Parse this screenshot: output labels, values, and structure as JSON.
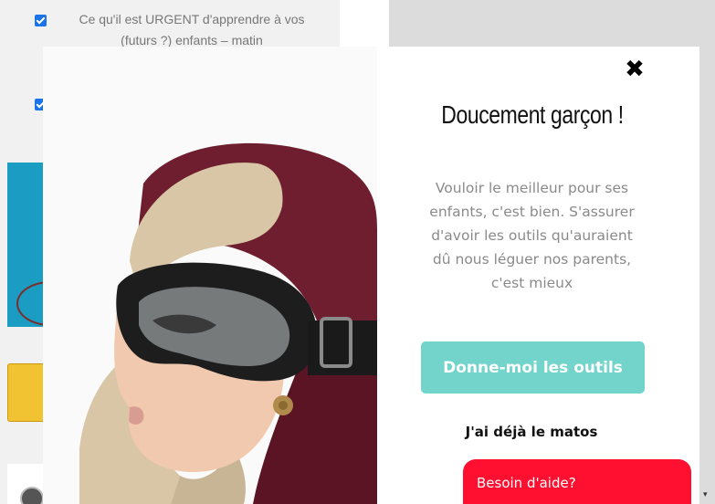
{
  "background": {
    "list_item_1": "Ce qu'il est URGENT d'apprendre à vos (futurs ?) enfants – matin"
  },
  "popup": {
    "close_icon": "close-icon",
    "close_symbol": "✖",
    "title": "Doucement garçon !",
    "description": "Vouloir le meilleur pour ses enfants, c'est bien. S'assurer d'avoir les outils qu'auraient dû nous léguer nos parents, c'est mieux",
    "cta_label": "Donne-moi les outils",
    "secondary_label": "J'ai déjà le matos",
    "cta_color": "#72d4cb"
  },
  "help_widget": {
    "label": "Besoin d'aide?",
    "color": "#ff1030"
  },
  "scrollbar": {
    "down_arrow": "▾"
  }
}
